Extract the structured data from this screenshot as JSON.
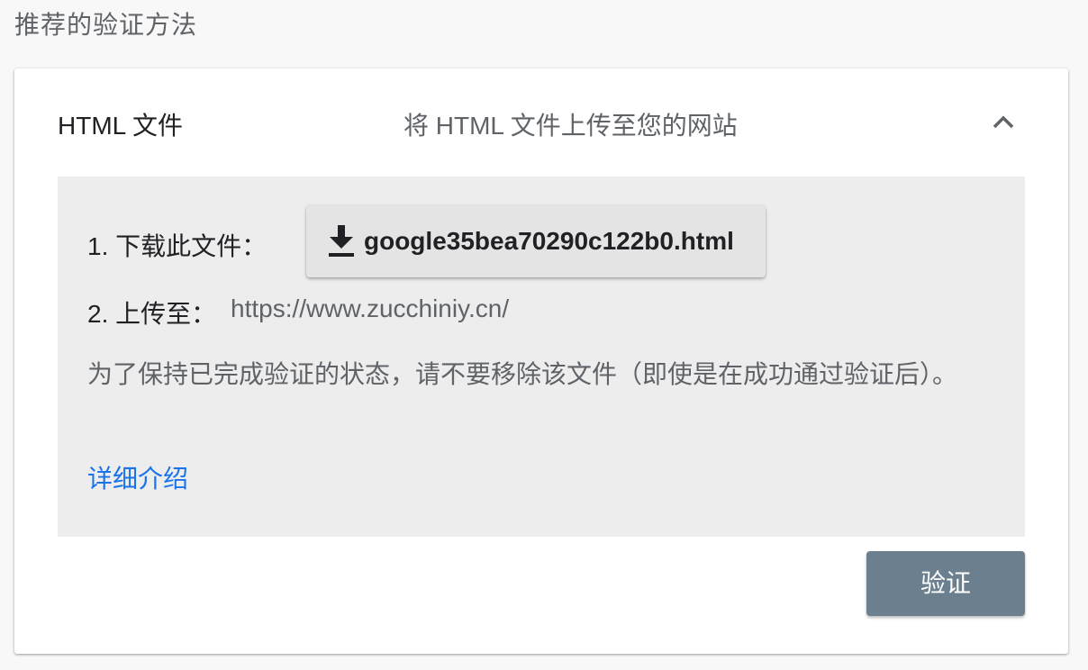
{
  "section": {
    "title": "推荐的验证方法"
  },
  "method": {
    "name": "HTML 文件",
    "description": "将 HTML 文件上传至您的网站",
    "toggle_icon": "chevron-up-icon"
  },
  "steps": {
    "step1_label": "1. 下载此文件：",
    "download_icon": "download-icon",
    "download_filename": "google35bea70290c122b0.html",
    "step2_label": "2. 上传至：",
    "upload_url": "https://www.zucchiniy.cn/"
  },
  "note": "为了保持已完成验证的状态，请不要移除该文件（即使是在成功通过验证后）。",
  "learn_more": "详细介绍",
  "verify_button": "验证",
  "colors": {
    "link": "#1a73e8",
    "verify_button_bg": "#6b7f8e",
    "panel_bg": "#ededed"
  }
}
